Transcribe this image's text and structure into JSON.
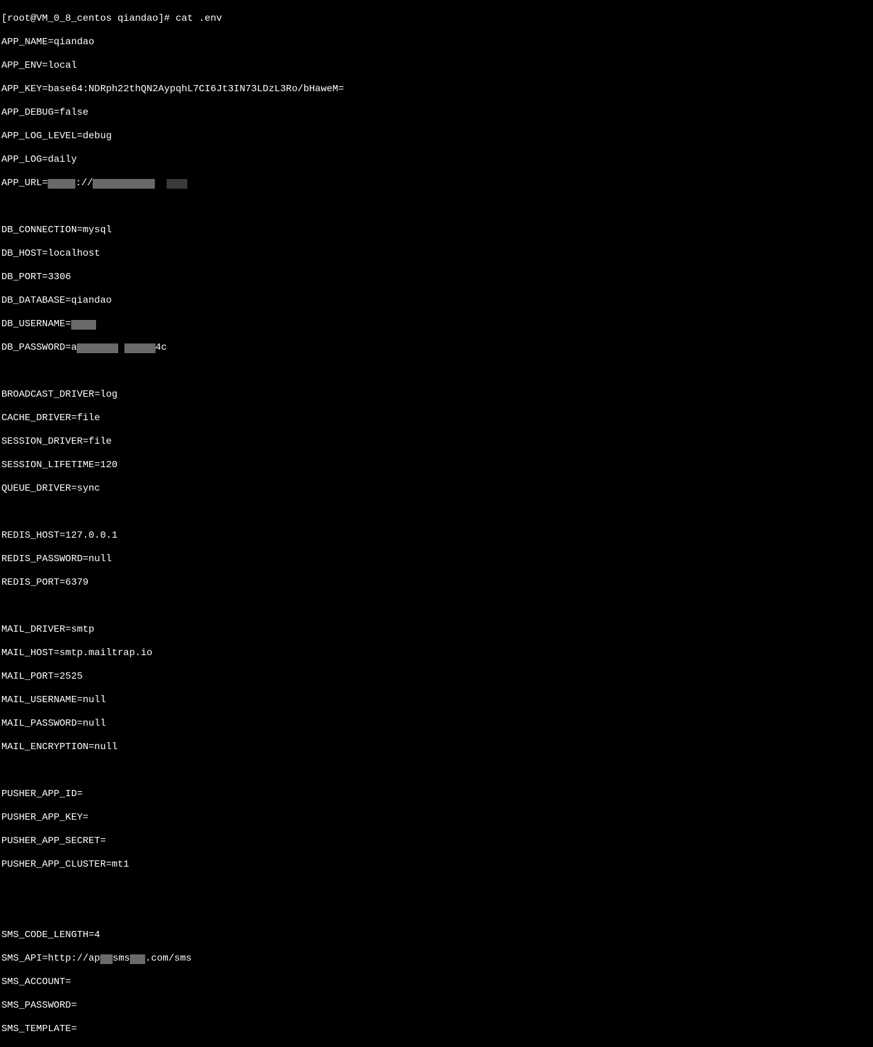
{
  "terminal": {
    "prompt": "[root@VM_0_8_centos qiandao]# ",
    "command": "cat .env",
    "lines": {
      "app_name": "APP_NAME=qiandao",
      "app_env": "APP_ENV=local",
      "app_key": "APP_KEY=base64:NDRph22thQN2AypqhL7CI6Jt3IN73LDzL3Ro/bHaweM=",
      "app_debug": "APP_DEBUG=false",
      "app_log_level": "APP_LOG_LEVEL=debug",
      "app_log": "APP_LOG=daily",
      "app_url_prefix": "APP_URL=",
      "db_connection": "DB_CONNECTION=mysql",
      "db_host": "DB_HOST=localhost",
      "db_port": "DB_PORT=3306",
      "db_database": "DB_DATABASE=qiandao",
      "db_username_prefix": "DB_USERNAME=",
      "db_password_prefix": "DB_PASSWORD=a",
      "db_password_suffix": "4c",
      "broadcast_driver": "BROADCAST_DRIVER=log",
      "cache_driver": "CACHE_DRIVER=file",
      "session_driver": "SESSION_DRIVER=file",
      "session_lifetime": "SESSION_LIFETIME=120",
      "queue_driver": "QUEUE_DRIVER=sync",
      "redis_host": "REDIS_HOST=127.0.0.1",
      "redis_password": "REDIS_PASSWORD=null",
      "redis_port": "REDIS_PORT=6379",
      "mail_driver": "MAIL_DRIVER=smtp",
      "mail_host": "MAIL_HOST=smtp.mailtrap.io",
      "mail_port": "MAIL_PORT=2525",
      "mail_username": "MAIL_USERNAME=null",
      "mail_password": "MAIL_PASSWORD=null",
      "mail_encryption": "MAIL_ENCRYPTION=null",
      "pusher_app_id": "PUSHER_APP_ID=",
      "pusher_app_key": "PUSHER_APP_KEY=",
      "pusher_app_secret": "PUSHER_APP_SECRET=",
      "pusher_app_cluster": "PUSHER_APP_CLUSTER=mt1",
      "sms_code_length": "SMS_CODE_LENGTH=4",
      "sms_api_prefix": "SMS_API=http://ap",
      "sms_api_mid": "sms",
      "sms_api_suffix": ".com/sms",
      "sms_account": "SMS_ACCOUNT=",
      "sms_password": "SMS_PASSWORD=",
      "sms_template": "SMS_TEMPLATE="
    }
  }
}
